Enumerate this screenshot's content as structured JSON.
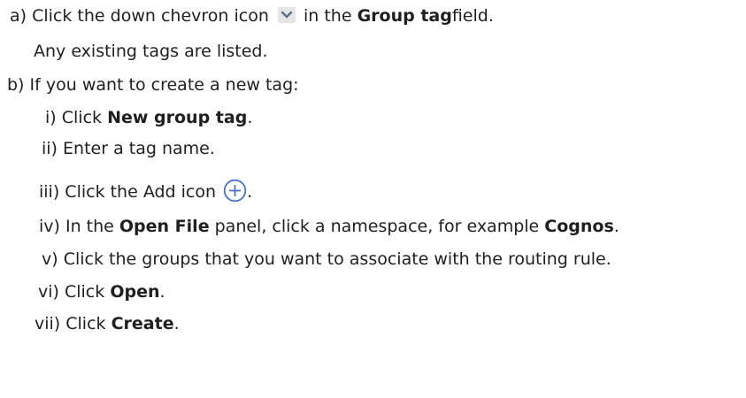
{
  "steps": {
    "a": {
      "marker": "a)",
      "pre": "Click the down chevron icon",
      "mid": "in the",
      "bold": "Group tag",
      "post": "field."
    },
    "a_note": "Any existing tags are listed.",
    "b": {
      "marker": "b)",
      "text": "If you want to create a new tag:"
    },
    "sub": [
      {
        "marker": "i)",
        "pre": "Click",
        "bold": "New group tag",
        "post": "."
      },
      {
        "marker": "ii)",
        "text": "Enter a tag name."
      },
      {
        "marker": "iii)",
        "pre": "Click the Add icon",
        "post": "."
      },
      {
        "marker": "iv)",
        "pre": "In the",
        "bold": "Open File",
        "mid": "panel, click a namespace, for example",
        "bold2": "Cognos",
        "post": "."
      },
      {
        "marker": "v)",
        "text": "Click the groups that you want to associate with the routing rule."
      },
      {
        "marker": "vi)",
        "pre": "Click",
        "bold": "Open",
        "post": "."
      },
      {
        "marker": "vii)",
        "pre": "Click",
        "bold": "Create",
        "post": "."
      }
    ]
  },
  "icons": {
    "chevron": "chevron-down-icon",
    "add": "add-circle-icon",
    "accent": "#4a74c9"
  }
}
